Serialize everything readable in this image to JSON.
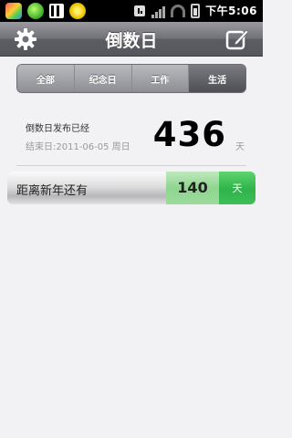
{
  "status_bar": {
    "time": "下午5:06",
    "icons": [
      "app-icon-colorful",
      "app-icon-green",
      "qr-icon",
      "app-icon-yellow",
      "sync-icon",
      "signal-icon",
      "wifi-icon",
      "battery-icon"
    ]
  },
  "header": {
    "title": "倒数日",
    "left_icon": "gear-icon",
    "right_icon": "edit-icon"
  },
  "tabs": [
    {
      "label": "全部",
      "active": false
    },
    {
      "label": "纪念日",
      "active": false
    },
    {
      "label": "工作",
      "active": false
    },
    {
      "label": "生活",
      "active": true
    }
  ],
  "main_event": {
    "title": "倒数日发布已经",
    "end_date": "结束日:2011-06-05 周日",
    "days": "436",
    "unit": "天"
  },
  "countdown_item": {
    "label": "距离新年还有",
    "days": "140",
    "unit": "天"
  },
  "colors": {
    "header_bg": "#6f7076",
    "tab_active": "#5c5d63",
    "number_bg": "#9cdb9c",
    "unit_bg": "#2fb34a"
  }
}
